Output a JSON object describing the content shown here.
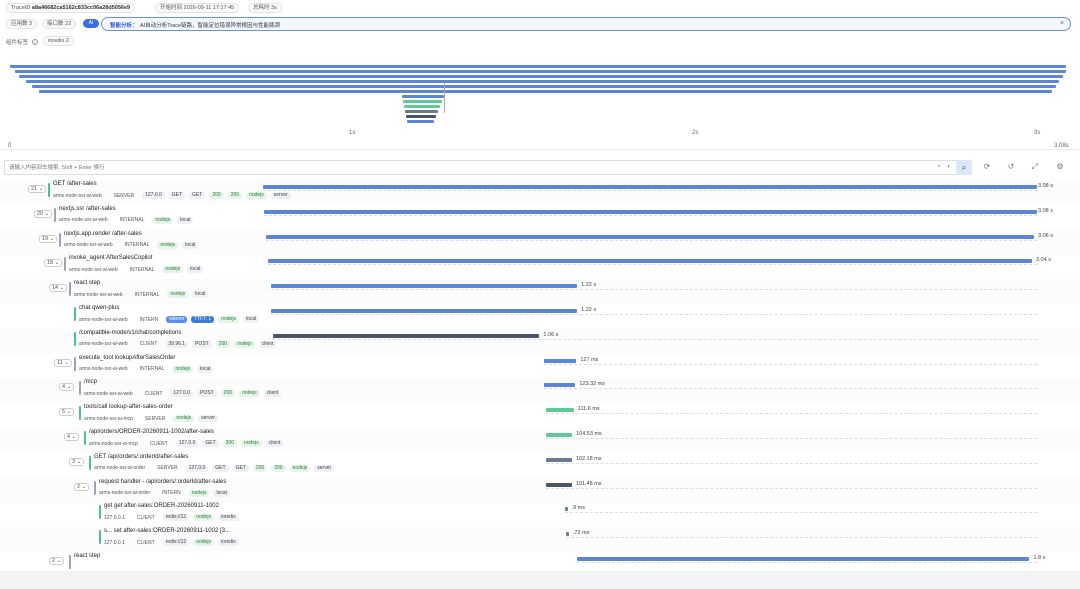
{
  "header": {
    "trace_label": "TraceID",
    "trace_id": "a8a46682ca5162c833cc06a28d5056e9",
    "start_label": "开始时间",
    "start_time": "2026-09-11 17:17:45",
    "duration_label": "总耗时",
    "duration": "3s",
    "apps_label": "应用数",
    "apps_count": "3",
    "endpoints_label": "接口数",
    "endpoints_count": "22"
  },
  "ai_banner": {
    "toggle": "AI",
    "label": "智能分析：",
    "text": "AI自动分析Trace链路，智能定位错误异常根因与性能瓶颈"
  },
  "tag_row": {
    "label": "组件标签",
    "tag": "ioredis",
    "count": "2"
  },
  "timeline_axis": {
    "ticks": [
      "0",
      "1s",
      "2s",
      "3s"
    ],
    "end": "3.08s",
    "total_s": 3.08
  },
  "search": {
    "placeholder": "请输入内容回车搜索, Shift + Enter 换行"
  },
  "colors": {
    "blue": "#5b86d6",
    "green": "#5fc79a",
    "gray": "#6b7a8f",
    "slate": "#4a5568",
    "accent_green": "#4cc18a"
  },
  "spans": [
    {
      "count": "21",
      "name": "GET /after-sales",
      "service": "arms-node-ssr-ai-web",
      "kind": "SERVER",
      "tags": [
        {
          "t": "127.0.0",
          "c": ""
        },
        {
          "t": "GET",
          "c": ""
        },
        {
          "t": "GET",
          "c": ""
        },
        {
          "t": "200",
          "c": "g"
        },
        {
          "t": "200",
          "c": "g"
        },
        {
          "t": "nodejs",
          "c": "g"
        },
        {
          "t": "server",
          "c": ""
        }
      ],
      "start": 0,
      "dur": 3.08,
      "dur_label": "3.08 s",
      "color": "blue"
    },
    {
      "count": "20",
      "name": "nextjs.ssr /after-sales",
      "service": "arms-node-ssr-ai-web",
      "kind": "INTERNAL",
      "tags": [
        {
          "t": "nodejs",
          "c": "g"
        },
        {
          "t": "local",
          "c": ""
        }
      ],
      "start": 0.005,
      "dur": 3.075,
      "dur_label": "3.08 s",
      "color": "blue"
    },
    {
      "count": "19",
      "name": "nextjs.app.render /after-sales",
      "service": "arms-node-ssr-ai-web",
      "kind": "INTERNAL",
      "tags": [
        {
          "t": "nodejs",
          "c": "g"
        },
        {
          "t": "local",
          "c": ""
        }
      ],
      "start": 0.01,
      "dur": 3.06,
      "dur_label": "3.06 s",
      "color": "blue"
    },
    {
      "count": "18",
      "name": "invoke_agent AfterSalesCopilot",
      "service": "arms-node-ssr-ai-web",
      "kind": "INTERNAL",
      "tags": [
        {
          "t": "nodejs",
          "c": "g"
        },
        {
          "t": "local",
          "c": ""
        }
      ],
      "start": 0.02,
      "dur": 3.04,
      "dur_label": "3.04 s",
      "color": "blue"
    },
    {
      "count": "14",
      "name": "react step",
      "service": "arms-node-ssr-ai-web",
      "kind": "INTERNAL",
      "tags": [
        {
          "t": "nodejs",
          "c": "g"
        },
        {
          "t": "local",
          "c": ""
        }
      ],
      "start": 0.03,
      "dur": 1.22,
      "dur_label": "1.22 s",
      "color": "blue"
    },
    {
      "count": "",
      "name": "chat qwen-plus",
      "service": "arms-node-ssr-ai-web",
      "kind": "INTERN",
      "tags": [
        {
          "t": "tokens",
          "c": "lb"
        },
        {
          "t": "TTFT: 1",
          "c": "b"
        },
        {
          "t": "nodejs",
          "c": "g"
        },
        {
          "t": "local",
          "c": ""
        }
      ],
      "start": 0.03,
      "dur": 1.22,
      "dur_label": "1.22 s",
      "color": "blue"
    },
    {
      "count": "",
      "name": "/compatible-mode/v1/chat/completions",
      "service": "arms-node-ssr-ai-web",
      "kind": "CLIENT",
      "tags": [
        {
          "t": "39.96.1",
          "c": ""
        },
        {
          "t": "POST",
          "c": ""
        },
        {
          "t": "200",
          "c": "g"
        },
        {
          "t": "nodejs",
          "c": "g"
        },
        {
          "t": "client",
          "c": ""
        }
      ],
      "start": 0.04,
      "dur": 1.06,
      "dur_label": "1.06 s",
      "color": "slate"
    },
    {
      "count": "11",
      "name": "execute_tool lookupAfterSalesOrder",
      "service": "arms-node-ssr-ai-web",
      "kind": "INTERNAL",
      "tags": [
        {
          "t": "nodejs",
          "c": "g"
        },
        {
          "t": "local",
          "c": ""
        }
      ],
      "start": 1.12,
      "dur": 0.127,
      "dur_label": "127 ms",
      "color": "blue"
    },
    {
      "count": "4",
      "name": "/mcp",
      "service": "arms-node-ssr-ai-web",
      "kind": "CLIENT",
      "tags": [
        {
          "t": "127.0.0",
          "c": ""
        },
        {
          "t": "POST",
          "c": ""
        },
        {
          "t": "200",
          "c": "g"
        },
        {
          "t": "nodejs",
          "c": "g"
        },
        {
          "t": "client",
          "c": ""
        }
      ],
      "start": 1.12,
      "dur": 0.123,
      "dur_label": "123.32 ms",
      "color": "blue"
    },
    {
      "count": "5",
      "name": "tools/call lookup-after-sales-order",
      "service": "arms-node-ssr-ai-mcp",
      "kind": "SERVER",
      "tags": [
        {
          "t": "nodejs",
          "c": "g"
        },
        {
          "t": "server",
          "c": ""
        }
      ],
      "start": 1.125,
      "dur": 0.112,
      "dur_label": "111.6 ms",
      "color": "green"
    },
    {
      "count": "4",
      "name": "/api/orders/ORDER-20260911-1002/after-sales",
      "service": "arms-node-ssr-ai-mcp",
      "kind": "CLIENT",
      "tags": [
        {
          "t": "127.0.0",
          "c": ""
        },
        {
          "t": "GET",
          "c": ""
        },
        {
          "t": "200",
          "c": "g"
        },
        {
          "t": "nodejs",
          "c": "g"
        },
        {
          "t": "client",
          "c": ""
        }
      ],
      "start": 1.125,
      "dur": 0.105,
      "dur_label": "104.53 ms",
      "color": "green"
    },
    {
      "count": "3",
      "name": "GET /api/orders/:orderId/after-sales",
      "service": "arms-node-ssr-ai-order",
      "kind": "SERVER",
      "tags": [
        {
          "t": "127.0.0",
          "c": ""
        },
        {
          "t": "GET",
          "c": ""
        },
        {
          "t": "GET",
          "c": ""
        },
        {
          "t": "200",
          "c": "g"
        },
        {
          "t": "200",
          "c": "g"
        },
        {
          "t": "nodejs",
          "c": "g"
        },
        {
          "t": "server",
          "c": ""
        }
      ],
      "start": 1.127,
      "dur": 0.102,
      "dur_label": "102.18 ms",
      "color": "gray"
    },
    {
      "count": "2",
      "name": "request handler - /api/orders/:orderId/after-sales",
      "service": "arms-node-ssr-ai-order",
      "kind": "INTERN",
      "tags": [
        {
          "t": "nodejs",
          "c": "g"
        },
        {
          "t": "local",
          "c": ""
        }
      ],
      "start": 1.128,
      "dur": 0.101,
      "dur_label": "101.48 ms",
      "color": "slate"
    },
    {
      "count": "",
      "name": "get    get after-sales:ORDER-20260911-1002",
      "service": "127.0.0.1",
      "kind": "CLIENT",
      "tags": [
        {
          "t": "redis://12",
          "c": ""
        },
        {
          "t": "nodejs",
          "c": "g"
        },
        {
          "t": "ioredis",
          "c": ""
        }
      ],
      "start": 1.2,
      "dur": 0.009,
      "dur_label": ".9 ms",
      "color": "gray"
    },
    {
      "count": "",
      "name": "s...   set after-sales:ORDER-20260911-1002 [3...",
      "service": "127.0.0.1",
      "kind": "CLIENT",
      "tags": [
        {
          "t": "redis://12",
          "c": ""
        },
        {
          "t": "nodejs",
          "c": "g"
        },
        {
          "t": "ioredis",
          "c": ""
        }
      ],
      "start": 1.205,
      "dur": 0.009,
      "dur_label": ".72 ms",
      "color": "gray"
    },
    {
      "count": "2",
      "name": "react step",
      "service": "",
      "kind": "",
      "tags": [],
      "start": 1.25,
      "dur": 1.8,
      "dur_label": "1.8 s",
      "color": "blue"
    }
  ],
  "indents": [
    48,
    54,
    59,
    64,
    69,
    74,
    74,
    74,
    79,
    79,
    84,
    89,
    94,
    99,
    99,
    69
  ],
  "overview_bars": [
    {
      "start": 0,
      "dur": 3.08,
      "color": "blue"
    },
    {
      "start": 0.005,
      "dur": 3.075,
      "color": "blue"
    },
    {
      "start": 0.01,
      "dur": 3.06,
      "color": "blue"
    },
    {
      "start": 0.02,
      "dur": 3.04,
      "color": "blue"
    },
    {
      "start": 0.03,
      "dur": 3.02,
      "color": "blue"
    },
    {
      "start": 0.04,
      "dur": 3.0,
      "color": "blue"
    },
    {
      "start": 1.12,
      "dur": 0.127,
      "color": "blue"
    },
    {
      "start": 1.125,
      "dur": 0.112,
      "color": "green"
    },
    {
      "start": 1.125,
      "dur": 0.105,
      "color": "green"
    },
    {
      "start": 1.127,
      "dur": 0.102,
      "color": "gray"
    },
    {
      "start": 1.128,
      "dur": 0.101,
      "color": "slate"
    },
    {
      "start": 1.25,
      "dur": 0.03,
      "color": "blue"
    }
  ]
}
